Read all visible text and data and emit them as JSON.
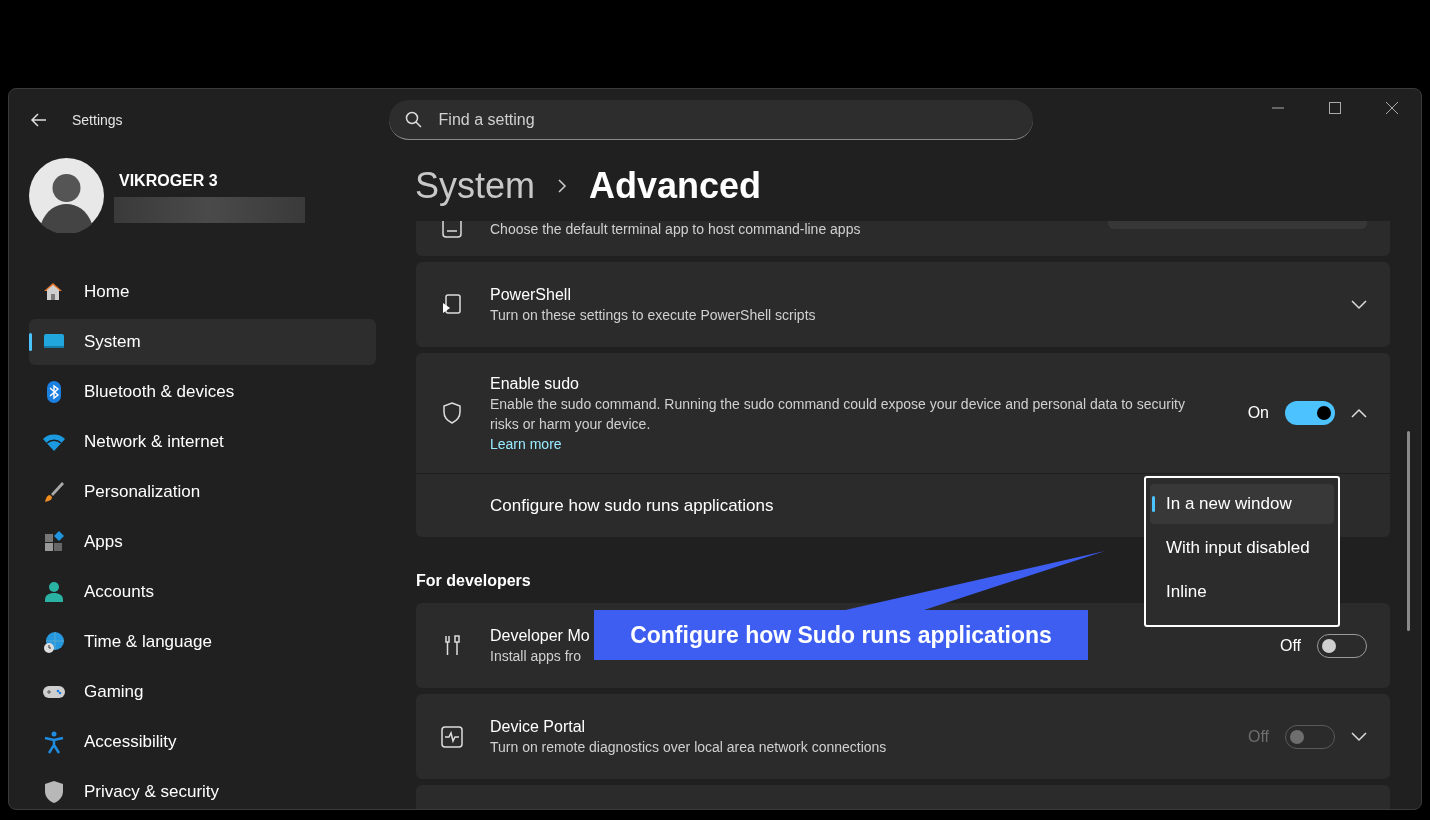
{
  "window": {
    "title": "Settings"
  },
  "search": {
    "placeholder": "Find a setting"
  },
  "profile": {
    "name": "VIKROGER 3"
  },
  "nav": [
    {
      "label": "Home",
      "kind": "home",
      "selected": false
    },
    {
      "label": "System",
      "kind": "system",
      "selected": true
    },
    {
      "label": "Bluetooth & devices",
      "kind": "bluetooth",
      "selected": false
    },
    {
      "label": "Network & internet",
      "kind": "network",
      "selected": false
    },
    {
      "label": "Personalization",
      "kind": "personalization",
      "selected": false
    },
    {
      "label": "Apps",
      "kind": "apps",
      "selected": false
    },
    {
      "label": "Accounts",
      "kind": "accounts",
      "selected": false
    },
    {
      "label": "Time & language",
      "kind": "time",
      "selected": false
    },
    {
      "label": "Gaming",
      "kind": "gaming",
      "selected": false
    },
    {
      "label": "Accessibility",
      "kind": "accessibility",
      "selected": false
    },
    {
      "label": "Privacy & security",
      "kind": "privacy",
      "selected": false
    }
  ],
  "breadcrumb": [
    {
      "label": "System",
      "selected": false
    },
    {
      "label": "Advanced",
      "selected": true
    }
  ],
  "content": [
    {
      "kind": "card",
      "description": "Choose the default terminal app to host command-line apps"
    },
    {
      "kind": "card",
      "title": "PowerShell",
      "description": "Turn on these settings to execute PowerShell scripts",
      "expanded": false
    },
    {
      "kind": "card",
      "title": "Enable sudo",
      "description": "Enable the sudo command. Running the sudo command could expose your device and personal data to security risks or harm your device.",
      "link": "Learn more",
      "toggle": {
        "label": "On",
        "on": true,
        "disabled": false
      },
      "expanded": true,
      "sub_rows": [
        {
          "label": "Configure how sudo runs applications"
        }
      ]
    },
    {
      "kind": "heading",
      "title": "For developers"
    },
    {
      "kind": "card",
      "title": "Developer Mo",
      "description": "Install apps fro",
      "toggle": {
        "label": "Off",
        "on": false,
        "disabled": false
      }
    },
    {
      "kind": "card",
      "title": "Device Portal",
      "description": "Turn on remote diagnostics over local area network connections",
      "toggle": {
        "label": "Off",
        "on": false,
        "disabled": true
      },
      "expanded": false
    },
    {
      "kind": "card"
    }
  ],
  "dropdown": {
    "options": [
      {
        "label": "In a new window",
        "selected": true
      },
      {
        "label": "With input disabled",
        "selected": false
      },
      {
        "label": "Inline",
        "selected": false
      }
    ]
  },
  "callout": {
    "text": "Configure how Sudo runs applications"
  }
}
